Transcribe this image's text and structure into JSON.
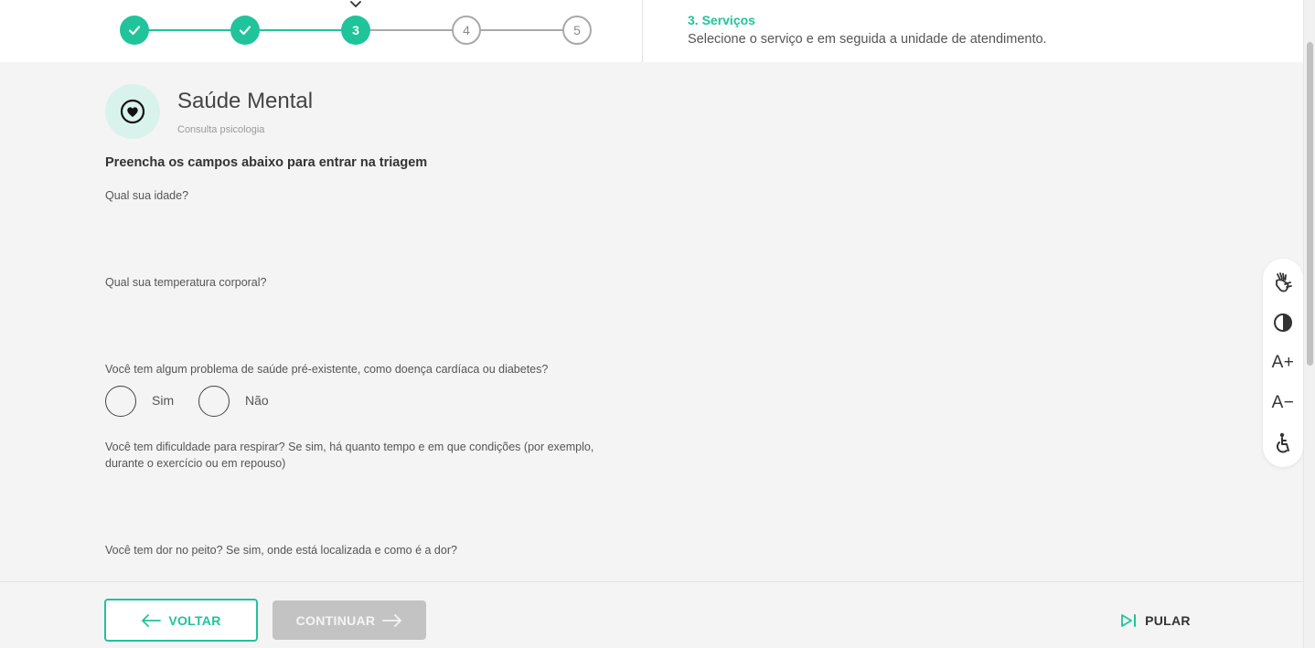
{
  "stepper": {
    "steps": [
      {
        "label": "",
        "state": "done"
      },
      {
        "label": "",
        "state": "done"
      },
      {
        "label": "3",
        "state": "current"
      },
      {
        "label": "4",
        "state": "todo"
      },
      {
        "label": "5",
        "state": "todo"
      }
    ],
    "current_title": "3. Serviços",
    "current_description": "Selecione o serviço e em seguida a unidade de atendimento."
  },
  "service": {
    "icon": "heart-icon",
    "title": "Saúde Mental",
    "subtitle": "Consulta psicologia"
  },
  "form": {
    "heading": "Preencha os campos abaixo para entrar na triagem",
    "questions": [
      "Qual sua idade?",
      "Qual sua temperatura corporal?",
      "Você tem algum problema de saúde pré-existente, como doença cardíaca ou diabetes?",
      "Você tem dificuldade para respirar? Se sim, há quanto tempo e em que condições (por exemplo, durante o exercício ou em repouso)",
      "Você tem dor no peito? Se sim, onde está localizada e como é a dor?"
    ],
    "radio_options": [
      "Sim",
      "Não"
    ]
  },
  "accessibility": {
    "font_increase": "A+",
    "font_decrease": "A−"
  },
  "footer": {
    "back_label": "VOLTAR",
    "next_label": "CONTINUAR",
    "skip_label": "PULAR"
  },
  "colors": {
    "accent": "#1fc49a",
    "disabled": "#c3c3c3"
  }
}
